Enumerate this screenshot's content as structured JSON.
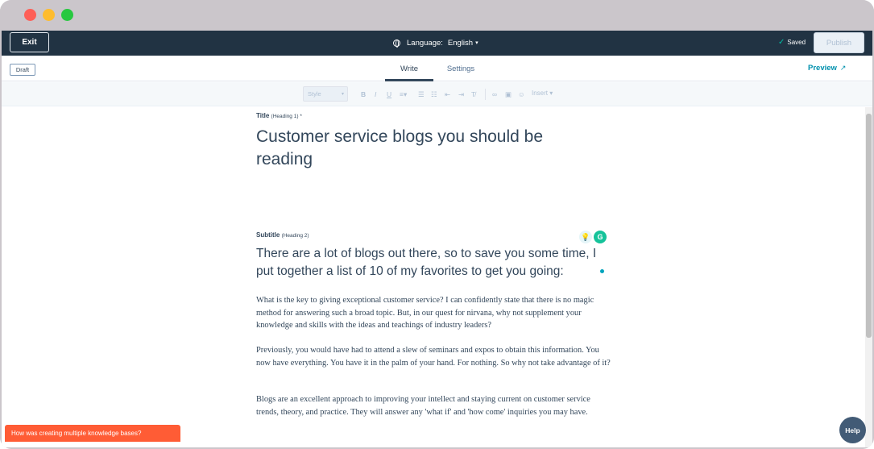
{
  "topbar": {
    "exit_label": "Exit",
    "language_label": "Language:",
    "language_value": "English",
    "saved_label": "Saved",
    "publish_label": "Publish"
  },
  "tabbar": {
    "draft_label": "Draft",
    "tabs": [
      {
        "label": "Write",
        "active": true
      },
      {
        "label": "Settings",
        "active": false
      }
    ],
    "preview_label": "Preview"
  },
  "toolbar": {
    "style_placeholder": "Style",
    "insert_label": "Insert",
    "buttons": [
      "bold-icon",
      "italic-icon",
      "underline-icon",
      "align-icon",
      "bulleted-list-icon",
      "numbered-list-icon",
      "indent-decrease-icon",
      "indent-increase-icon",
      "clear-format-icon",
      "link-icon",
      "image-icon",
      "emoji-icon"
    ]
  },
  "editor": {
    "title_label": "Title",
    "title_hint": "(Heading 1) *",
    "title_value": "Customer service blogs you should be reading",
    "subtitle_label": "Subtitle",
    "subtitle_hint": "(Heading 2)",
    "subtitle_value": "There are a lot of blogs out there, so to save you some time, I put together a list of 10 of my favorites to get you going:",
    "paragraphs": [
      "What is the key to giving exceptional customer service? I can confidently state that there is no magic method for answering such a broad topic. But, in our quest for nirvana, why not supplement your knowledge and skills with the ideas and teachings of industry leaders?",
      "Previously, you would have had to attend a slew of seminars and expos to obtain this information. You now have everything. You have it in the palm of your hand. For nothing. So why not take advantage of it?",
      "Blogs are an excellent approach to improving your intellect and staying current on customer service trends, theory, and practice. They will answer any 'what if' and 'how come' inquiries you may have."
    ],
    "grammarly_letter": "G"
  },
  "feedback_label": "How was creating multiple knowledge bases?",
  "help_label": "Help",
  "colors": {
    "topbar": "#213343",
    "accent_teal": "#0091ae",
    "feedback_orange": "#ff5c35",
    "help_blue": "#425b76",
    "text_primary": "#33475b"
  }
}
